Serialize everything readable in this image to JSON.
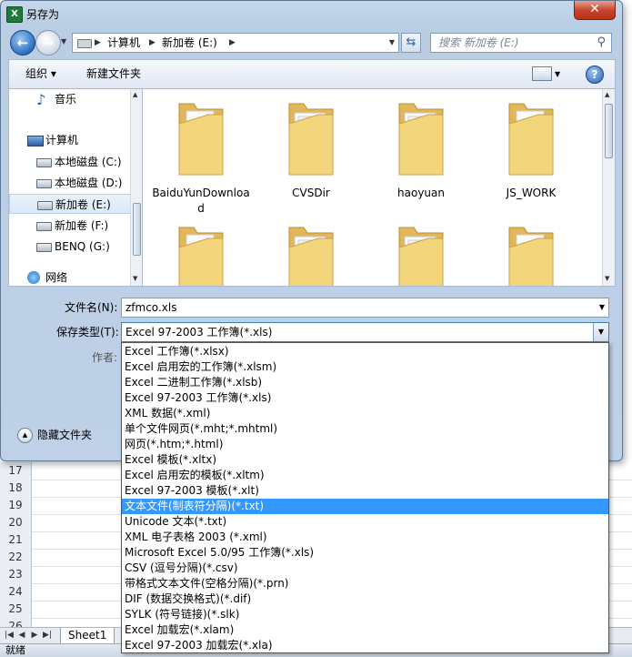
{
  "dialog": {
    "title": "另存为",
    "app_icon_letter": "X",
    "close_glyph": "✕",
    "address": {
      "segments": [
        "计算机",
        "新加卷 (E:)"
      ]
    },
    "search_placeholder": "搜索 新加卷 (E:)",
    "toolbar": {
      "organize": "组织 ▾",
      "new_folder": "新建文件夹",
      "help": "?"
    },
    "nav": {
      "items": [
        {
          "label": "音乐",
          "icon": "music-icon"
        },
        {
          "label": "计算机",
          "icon": "computer-icon"
        },
        {
          "label": "本地磁盘 (C:)",
          "icon": "drive-icon"
        },
        {
          "label": "本地磁盘 (D:)",
          "icon": "drive-icon"
        },
        {
          "label": "新加卷 (E:)",
          "icon": "drive-icon",
          "selected": true
        },
        {
          "label": "新加卷 (F:)",
          "icon": "drive-icon"
        },
        {
          "label": "BENQ (G:)",
          "icon": "drive-icon"
        },
        {
          "label": "网络",
          "icon": "network-icon"
        }
      ]
    },
    "folders": [
      {
        "name": "BaiduYunDownload"
      },
      {
        "name": "CVSDir"
      },
      {
        "name": "haoyuan"
      },
      {
        "name": "JS_WORK"
      },
      {
        "name": ""
      },
      {
        "name": ""
      },
      {
        "name": ""
      },
      {
        "name": ""
      }
    ],
    "filename_label": "文件名(N):",
    "filename_value": "zfmco.xls",
    "savetype_label": "保存类型(T):",
    "savetype_value": "Excel 97-2003 工作簿(*.xls)",
    "author_label": "作者:",
    "hide_folders": "隐藏文件夹",
    "type_options": [
      "Excel 工作簿(*.xlsx)",
      "Excel 启用宏的工作簿(*.xlsm)",
      "Excel 二进制工作簿(*.xlsb)",
      "Excel 97-2003 工作簿(*.xls)",
      "XML 数据(*.xml)",
      "单个文件网页(*.mht;*.mhtml)",
      "网页(*.htm;*.html)",
      "Excel 模板(*.xltx)",
      "Excel 启用宏的模板(*.xltm)",
      "Excel 97-2003 模板(*.xlt)",
      "文本文件(制表符分隔)(*.txt)",
      "Unicode 文本(*.txt)",
      "XML 电子表格 2003 (*.xml)",
      "Microsoft Excel 5.0/95 工作簿(*.xls)",
      "CSV (逗号分隔)(*.csv)",
      "带格式文本文件(空格分隔)(*.prn)",
      "DIF (数据交换格式)(*.dif)",
      "SYLK (符号链接)(*.slk)",
      "Excel 加载宏(*.xlam)",
      "Excel 97-2003 加载宏(*.xla)"
    ],
    "selected_option_index": 10
  },
  "excel": {
    "row_numbers": [
      "17",
      "18",
      "19",
      "20",
      "21",
      "22",
      "23",
      "24",
      "25",
      "26"
    ],
    "sheet_tab": "Sheet1",
    "status": "就绪"
  },
  "colors": {
    "selection": "#3399ff",
    "folder": "#f2d27a"
  }
}
